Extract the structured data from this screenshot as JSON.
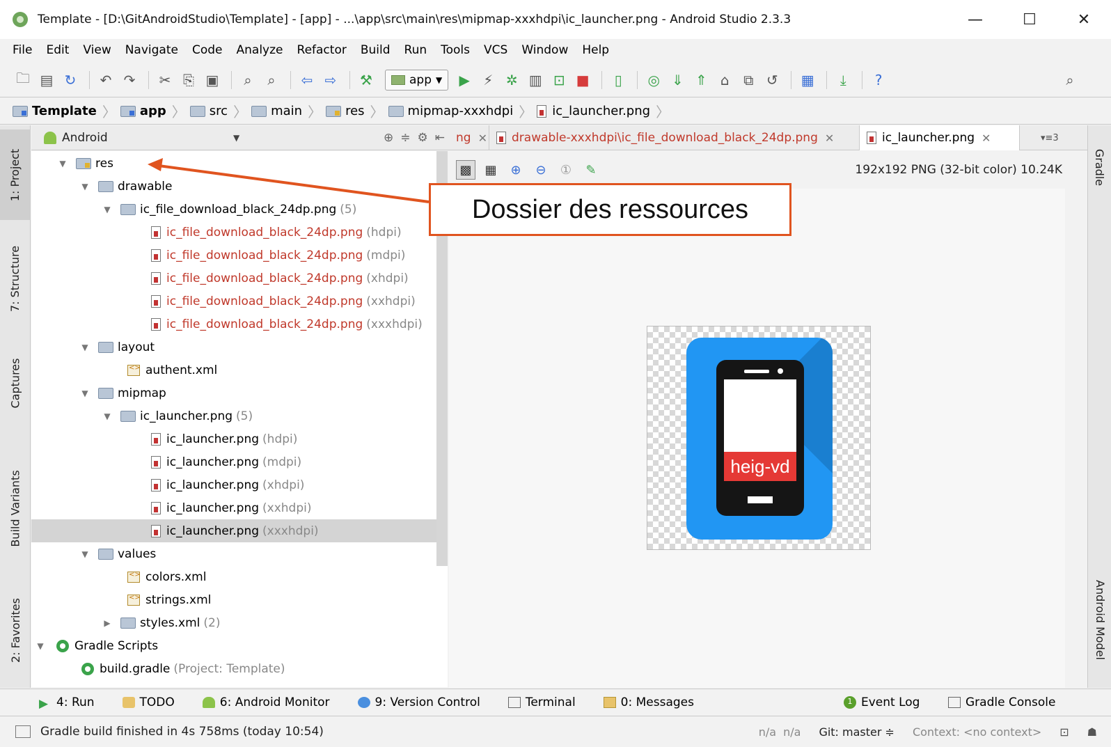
{
  "window": {
    "title": "Template - [D:\\GitAndroidStudio\\Template] - [app] - ...\\app\\src\\main\\res\\mipmap-xxxhdpi\\ic_launcher.png - Android Studio 2.3.3",
    "minimize": "—",
    "maximize": "☐",
    "close": "✕"
  },
  "menu": [
    {
      "label": "File"
    },
    {
      "label": "Edit"
    },
    {
      "label": "View"
    },
    {
      "label": "Navigate"
    },
    {
      "label": "Code"
    },
    {
      "label": "Analyze"
    },
    {
      "label": "Refactor"
    },
    {
      "label": "Build"
    },
    {
      "label": "Run"
    },
    {
      "label": "Tools"
    },
    {
      "label": "VCS"
    },
    {
      "label": "Window"
    },
    {
      "label": "Help"
    }
  ],
  "toolbar": {
    "run_config": "app",
    "icons": [
      "open-icon",
      "save-icon",
      "sync-icon",
      "undo-icon",
      "redo-icon",
      "cut-icon",
      "copy-icon",
      "paste-icon",
      "find-icon",
      "replace-icon",
      "back-icon",
      "forward-icon",
      "make-icon",
      "run-icon",
      "apply-changes-icon",
      "debug-icon",
      "profile-icon",
      "attach-debugger-icon",
      "stop-icon",
      "avd-manager-icon",
      "sync-gradle-icon",
      "vcs-update-icon",
      "vcs-commit-icon",
      "vcs-history-icon",
      "vcs-compare-icon",
      "revert-icon",
      "project-structure-icon",
      "sdk-manager-icon",
      "help-icon",
      "search-everywhere-icon"
    ]
  },
  "breadcrumb": [
    {
      "label": "Template",
      "bold": true
    },
    {
      "label": "app",
      "bold": true
    },
    {
      "label": "src"
    },
    {
      "label": "main"
    },
    {
      "label": "res"
    },
    {
      "label": "mipmap-xxxhdpi"
    },
    {
      "label": "ic_launcher.png"
    }
  ],
  "side_tabs_left": {
    "project": "1: Project",
    "structure": "7: Structure",
    "captures": "Captures",
    "build_variants": "Build Variants",
    "favorites": "2: Favorites"
  },
  "side_tabs_right": {
    "gradle": "Gradle",
    "android_model": "Android Model"
  },
  "project_panel": {
    "view": "Android"
  },
  "tree": [
    {
      "label": "res",
      "extra": "",
      "icon": "res-folder-icon",
      "red": false
    },
    {
      "label": "drawable",
      "extra": "",
      "icon": "folder-icon",
      "red": false
    },
    {
      "label": "ic_file_download_black_24dp.png",
      "extra": "(5)",
      "icon": "folder-icon",
      "red": false
    },
    {
      "label": "ic_file_download_black_24dp.png",
      "extra": "(hdpi)",
      "icon": "image-file-icon",
      "red": true
    },
    {
      "label": "ic_file_download_black_24dp.png",
      "extra": "(mdpi)",
      "icon": "image-file-icon",
      "red": true
    },
    {
      "label": "ic_file_download_black_24dp.png",
      "extra": "(xhdpi)",
      "icon": "image-file-icon",
      "red": true
    },
    {
      "label": "ic_file_download_black_24dp.png",
      "extra": "(xxhdpi)",
      "icon": "image-file-icon",
      "red": true
    },
    {
      "label": "ic_file_download_black_24dp.png",
      "extra": "(xxxhdpi)",
      "icon": "image-file-icon",
      "red": true
    },
    {
      "label": "layout",
      "extra": "",
      "icon": "folder-icon",
      "red": false
    },
    {
      "label": "authent.xml",
      "extra": "",
      "icon": "xml-file-icon",
      "red": false
    },
    {
      "label": "mipmap",
      "extra": "",
      "icon": "folder-icon",
      "red": false
    },
    {
      "label": "ic_launcher.png",
      "extra": "(5)",
      "icon": "folder-icon",
      "red": false
    },
    {
      "label": "ic_launcher.png",
      "extra": "(hdpi)",
      "icon": "image-file-icon",
      "red": false
    },
    {
      "label": "ic_launcher.png",
      "extra": "(mdpi)",
      "icon": "image-file-icon",
      "red": false
    },
    {
      "label": "ic_launcher.png",
      "extra": "(xhdpi)",
      "icon": "image-file-icon",
      "red": false
    },
    {
      "label": "ic_launcher.png",
      "extra": "(xxhdpi)",
      "icon": "image-file-icon",
      "red": false
    },
    {
      "label": "ic_launcher.png",
      "extra": "(xxxhdpi)",
      "icon": "image-file-icon",
      "red": false
    },
    {
      "label": "values",
      "extra": "",
      "icon": "folder-icon",
      "red": false
    },
    {
      "label": "colors.xml",
      "extra": "",
      "icon": "xml-file-icon",
      "red": false
    },
    {
      "label": "strings.xml",
      "extra": "",
      "icon": "xml-file-icon",
      "red": false
    },
    {
      "label": "styles.xml",
      "extra": "(2)",
      "icon": "folder-icon",
      "red": false
    },
    {
      "label": "Gradle Scripts",
      "extra": "",
      "icon": "gradle-icon",
      "red": false
    },
    {
      "label": "build.gradle",
      "extra": "(Project: Template)",
      "icon": "gradle-icon",
      "red": false
    }
  ],
  "tabs": {
    "partial": "ng",
    "drawable": "drawable-xxxhdpi\\ic_file_download_black_24dp.png",
    "launcher": "ic_launcher.png",
    "overflow": "▾≡3"
  },
  "image_info": "192x192 PNG (32-bit color) 10.24K",
  "launcher_icon": {
    "brand_text": "heig-vd",
    "bg_color": "#2196f3",
    "band_color": "#e53935"
  },
  "annotation": {
    "text": "Dossier des ressources",
    "color": "#e0541f"
  },
  "tool_windows": {
    "run": "4: Run",
    "todo": "TODO",
    "android_monitor": "6: Android Monitor",
    "version_control": "9: Version Control",
    "terminal": "Terminal",
    "messages": "0: Messages",
    "event_log": "Event Log",
    "event_log_count": "1",
    "gradle_console": "Gradle Console"
  },
  "status": {
    "message": "Gradle build finished in 4s 758ms (today 10:54)",
    "na1": "n/a",
    "na2": "n/a",
    "git": "Git: master ≑",
    "context": "Context: <no context>"
  }
}
